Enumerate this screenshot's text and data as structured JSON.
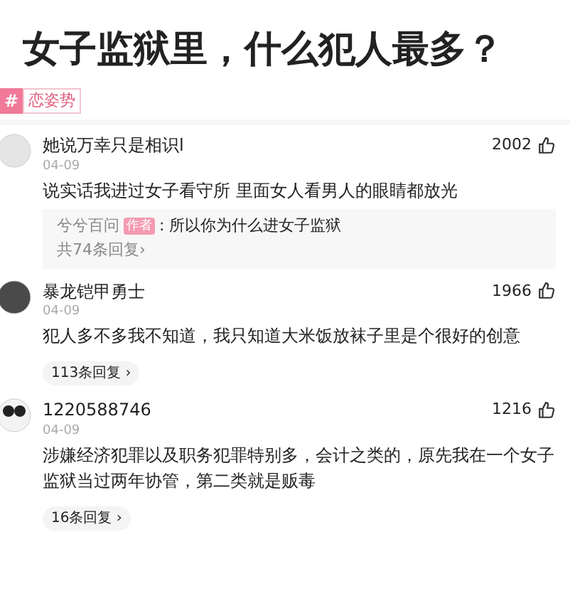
{
  "title": "女子监狱里，什么犯人最多？",
  "tag": {
    "icon": "#",
    "label": "恋姿势"
  },
  "comments": [
    {
      "kind": "preview",
      "user": "她说万幸只是相识l",
      "date": "04-09",
      "likes": "2002",
      "text": "说实话我进过女子看守所 里面女人看男人的眼睛都放光",
      "reply": {
        "user": "兮兮百问",
        "badge": "作者",
        "text": ": 所以你为什么进女子监狱"
      },
      "replies": "共74条回复›"
    },
    {
      "kind": "pill",
      "user": "暴龙铠甲勇士",
      "date": "04-09",
      "likes": "1966",
      "text": "犯人多不多我不知道，我只知道大米饭放袜子里是个很好的创意",
      "replies": "113条回复 ›"
    },
    {
      "kind": "pill",
      "user": "1220588746",
      "date": "04-09",
      "likes": "1216",
      "text": "涉嫌经济犯罪以及职务犯罪特别多，会计之类的，原先我在一个女子监狱当过两年协管，第二类就是贩毒",
      "replies": "16条回复 ›"
    }
  ]
}
